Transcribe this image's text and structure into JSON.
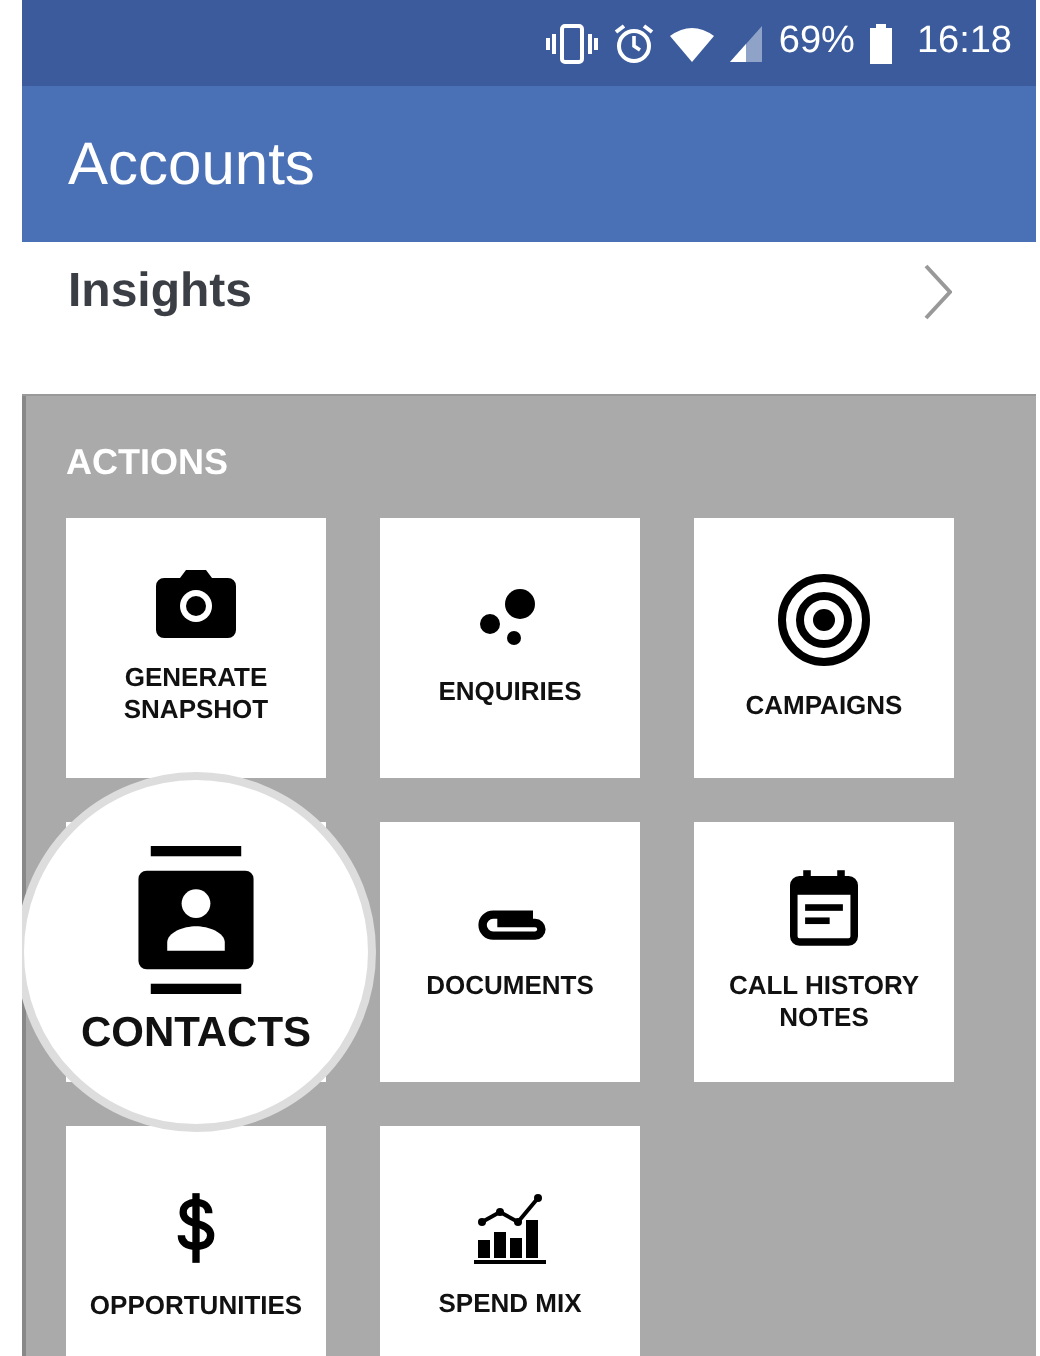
{
  "status_bar": {
    "battery_text": "69%",
    "time": "16:18"
  },
  "app_bar": {
    "title": "Accounts"
  },
  "insights": {
    "label": "Insights"
  },
  "actions": {
    "heading": "ACTIONS",
    "tiles": [
      {
        "kind": "camera",
        "label": "GENERATE SNAPSHOT",
        "spotlight": false
      },
      {
        "kind": "bubbles",
        "label": "ENQUIRIES",
        "spotlight": false
      },
      {
        "kind": "target",
        "label": "CAMPAIGNS",
        "spotlight": false
      },
      {
        "kind": "contact",
        "label": "CONTACTS",
        "spotlight": true
      },
      {
        "kind": "clip",
        "label": "DOCUMENTS",
        "spotlight": false
      },
      {
        "kind": "note",
        "label": "CALL HISTORY NOTES",
        "spotlight": false
      },
      {
        "kind": "dollar",
        "label": "OPPORTUNITIES",
        "spotlight": false
      },
      {
        "kind": "chart",
        "label": "SPEND MIX",
        "spotlight": false
      }
    ]
  }
}
